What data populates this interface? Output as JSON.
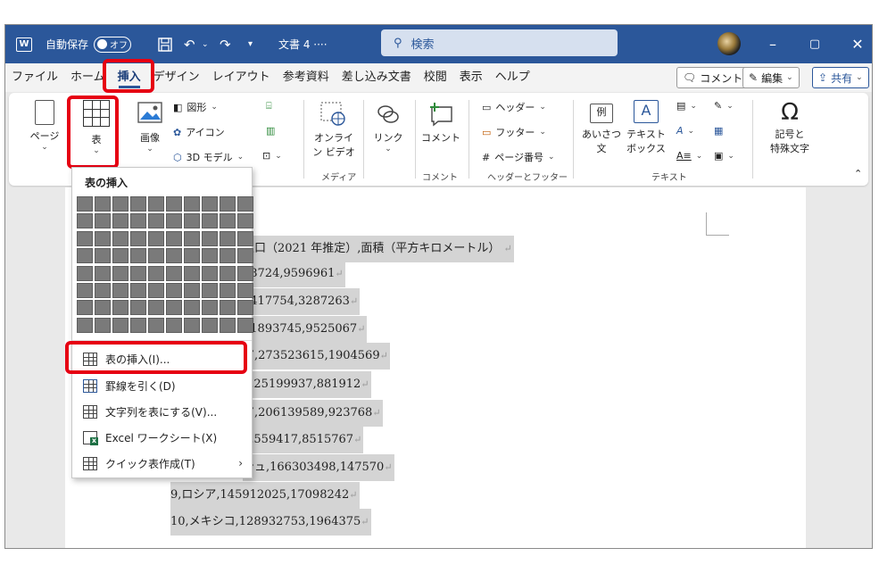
{
  "titlebar": {
    "app_badge": "W",
    "autosave_label": "自動保存",
    "autosave_state": "オフ",
    "doc_title": "文書 4 ····",
    "search_placeholder": "検索",
    "minimize": "–",
    "maximize": "▢",
    "close": "✕"
  },
  "menu": {
    "tabs": [
      "ファイル",
      "ホーム",
      "挿入",
      "デザイン",
      "レイアウト",
      "参考資料",
      "差し込み文書",
      "校閲",
      "表示",
      "ヘルプ"
    ],
    "comment_button": "コメント",
    "edit_button": "編集",
    "share_button": "共有"
  },
  "ribbon": {
    "page": "ページ",
    "table": "表",
    "image": "画像",
    "shapes": "図形",
    "icons": "アイコン",
    "model3d": "3D モデル",
    "online_video_line1": "オンライ",
    "online_video_line2": "ン ビデオ",
    "link": "リンク",
    "comment": "コメント",
    "header": "ヘッダー",
    "footer": "フッター",
    "page_number": "ページ番号",
    "greeting_line1": "あいさつ",
    "greeting_line2": "文",
    "textbox_line1": "テキスト",
    "textbox_line2": "ボックス",
    "symbol_line1": "記号と",
    "symbol_line2": "特殊文字",
    "group_media": "メディア",
    "group_comment": "コメント",
    "group_header_footer": "ヘッダーとフッター",
    "group_text": "テキスト"
  },
  "document": {
    "lines": [
      "人口（2021 年推定）,面積（平方キロメートル）",
      "78724,9596961",
      "5417754,3287263",
      "31893745,9525067",
      "ア,273523615,1904569",
      ",225199937,881912",
      "ア,206139589,923768",
      ",2559417,8515767",
      "シュ,166303498,147570",
      "9,ロシア,145912025,17098242",
      "10,メキシコ,128932753,1964375"
    ]
  },
  "dropdown": {
    "title": "表の挿入",
    "items": [
      {
        "label": "表の挿入(I)..."
      },
      {
        "label": "罫線を引く(D)"
      },
      {
        "label": "文字列を表にする(V)..."
      },
      {
        "label": "Excel ワークシート(X)"
      },
      {
        "label": "クイック表作成(T)"
      }
    ]
  },
  "colors": {
    "titlebar": "#2b579a",
    "highlight": "#e60012",
    "selection": "#d4d4d4"
  }
}
